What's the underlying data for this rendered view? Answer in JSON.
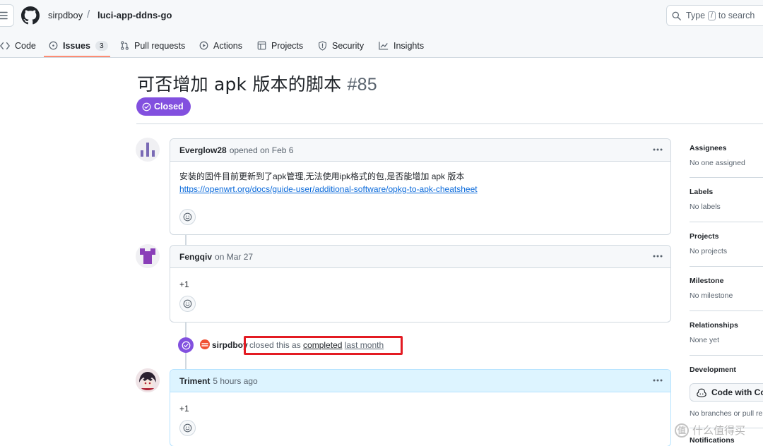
{
  "repo": {
    "owner": "sirpdboy",
    "separator": "/",
    "name": "luci-app-ddns-go"
  },
  "search": {
    "prefix": "Type",
    "key": "/",
    "suffix": "to search"
  },
  "tabs": [
    {
      "label": "Code"
    },
    {
      "label": "Issues",
      "count": "3"
    },
    {
      "label": "Pull requests"
    },
    {
      "label": "Actions"
    },
    {
      "label": "Projects"
    },
    {
      "label": "Security"
    },
    {
      "label": "Insights"
    }
  ],
  "issue": {
    "title": "可否增加 apk 版本的脚本",
    "number": "#85",
    "state": "Closed"
  },
  "comments": [
    {
      "author": "Everglow28",
      "meta": "opened on Feb 6",
      "body": "安装的固件目前更新到了apk管理,无法使用ipk格式的包,是否能增加 apk 版本",
      "link": "https://openwrt.org/docs/guide-user/additional-software/opkg-to-apk-cheatsheet"
    },
    {
      "author": "Fengqiv",
      "meta": "on Mar 27",
      "body": "+1"
    },
    {
      "author": "Triment",
      "meta": "5 hours ago",
      "body": "+1"
    }
  ],
  "event": {
    "actor": "sirpdboy",
    "text": "closed this as",
    "state": "completed",
    "when": "last month"
  },
  "sidebar": [
    {
      "title": "Assignees",
      "value": "No one assigned"
    },
    {
      "title": "Labels",
      "value": "No labels"
    },
    {
      "title": "Projects",
      "value": "No projects"
    },
    {
      "title": "Milestone",
      "value": "No milestone"
    },
    {
      "title": "Relationships",
      "value": "None yet"
    },
    {
      "title": "Development",
      "button": "Code with Co",
      "value": "No branches or pull re"
    },
    {
      "title": "Notifications"
    }
  ],
  "watermark": {
    "text": "什么值得买",
    "mark": "值"
  },
  "colors": {
    "accent": "#8250df",
    "link": "#0969da",
    "highlight": "#e31b23",
    "tab_underline": "#fd8c73"
  }
}
